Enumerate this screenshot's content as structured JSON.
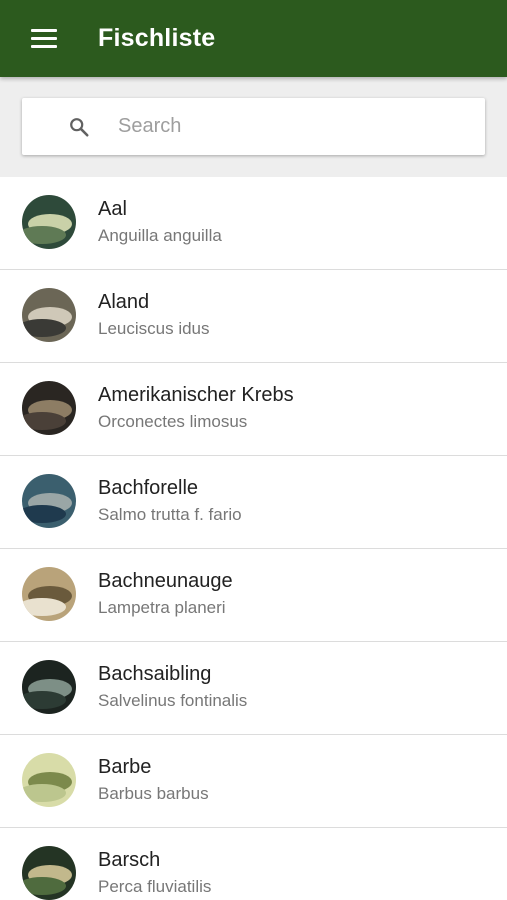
{
  "app_bar": {
    "title": "Fischliste",
    "menu_icon": "menu-icon",
    "background_color": "#2c5a1e"
  },
  "search": {
    "placeholder": "Search",
    "value": "",
    "icon": "search-icon"
  },
  "fish": [
    {
      "name": "Aal",
      "latin": "Anguilla anguilla",
      "thumb_colors": [
        "#5f7a55",
        "#c9d1a8",
        "#2e4a3a"
      ]
    },
    {
      "name": "Aland",
      "latin": "Leuciscus idus",
      "thumb_colors": [
        "#3a3a36",
        "#cfc8b8",
        "#6b6656"
      ]
    },
    {
      "name": "Amerikanischer Krebs",
      "latin": "Orconectes limosus",
      "thumb_colors": [
        "#4a4038",
        "#8d7d64",
        "#2a2622"
      ]
    },
    {
      "name": "Bachforelle",
      "latin": "Salmo trutta f. fario",
      "thumb_colors": [
        "#1f3a4e",
        "#9aa6a6",
        "#3b5f6e"
      ]
    },
    {
      "name": "Bachneunauge",
      "latin": "Lampetra planeri",
      "thumb_colors": [
        "#e9e1cf",
        "#6a5a3c",
        "#b9a37a"
      ]
    },
    {
      "name": "Bachsaibling",
      "latin": "Salvelinus fontinalis",
      "thumb_colors": [
        "#2c3b34",
        "#7d8f86",
        "#1c2420"
      ]
    },
    {
      "name": "Barbe",
      "latin": "Barbus barbus",
      "thumb_colors": [
        "#bcc68e",
        "#7c8a4c",
        "#d8dca8"
      ]
    },
    {
      "name": "Barsch",
      "latin": "Perca fluviatilis",
      "thumb_colors": [
        "#4f6b3e",
        "#c2b88c",
        "#243424"
      ]
    }
  ]
}
